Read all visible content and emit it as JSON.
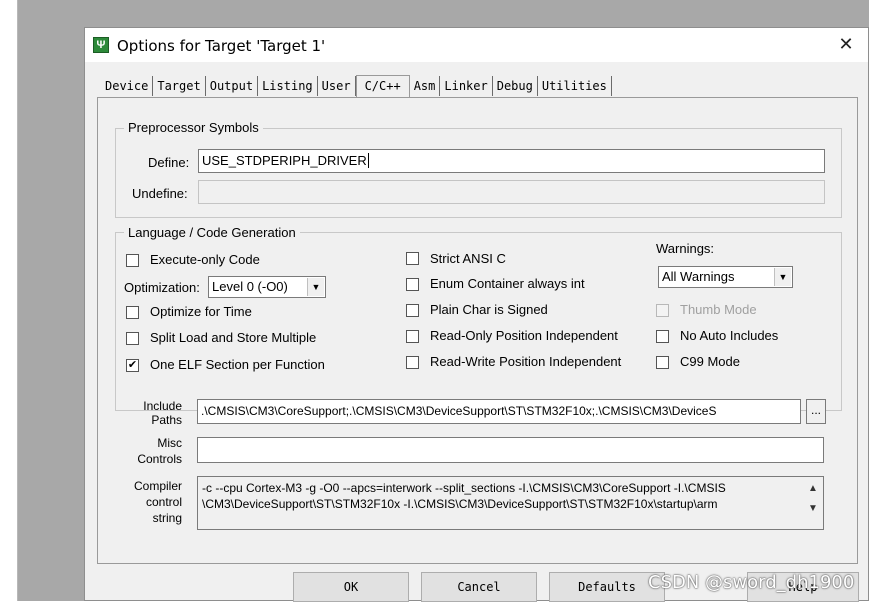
{
  "dialog": {
    "title": "Options for Target 'Target 1'",
    "icon": "keil-app-icon",
    "icon_glyph": "Ψ",
    "close_symbol": "✕"
  },
  "tabs": [
    "Device",
    "Target",
    "Output",
    "Listing",
    "User",
    "C/C++",
    "Asm",
    "Linker",
    "Debug",
    "Utilities"
  ],
  "active_tab": "C/C++",
  "preprocessor": {
    "legend": "Preprocessor Symbols",
    "define_label": "Define:",
    "define_value": "USE_STDPERIPH_DRIVER",
    "undefine_label": "Undefine:",
    "undefine_value": ""
  },
  "language": {
    "legend": "Language / Code Generation",
    "execute_only": {
      "label": "Execute-only Code",
      "checked": false
    },
    "optimization_label": "Optimization:",
    "optimization_value": "Level 0 (-O0)",
    "optimize_time": {
      "label": "Optimize for Time",
      "checked": false
    },
    "split_load": {
      "label": "Split Load and Store Multiple",
      "checked": false
    },
    "one_elf": {
      "label": "One ELF Section per Function",
      "checked": true
    },
    "strict_ansi": {
      "label": "Strict ANSI C",
      "checked": false
    },
    "enum_container": {
      "label": "Enum Container always int",
      "checked": false
    },
    "plain_char": {
      "label": "Plain Char is Signed",
      "checked": false
    },
    "ro_pos": {
      "label": "Read-Only Position Independent",
      "checked": false
    },
    "rw_pos": {
      "label": "Read-Write Position Independent",
      "checked": false
    },
    "warnings_label": "Warnings:",
    "warnings_value": "All Warnings",
    "thumb_mode": {
      "label": "Thumb Mode",
      "checked": false,
      "disabled": true
    },
    "no_auto_includes": {
      "label": "No Auto Includes",
      "checked": false
    },
    "c99_mode": {
      "label": "C99 Mode",
      "checked": false
    }
  },
  "include": {
    "label_line1": "Include",
    "label_line2": "Paths",
    "value": ".\\CMSIS\\CM3\\CoreSupport;.\\CMSIS\\CM3\\DeviceSupport\\ST\\STM32F10x;.\\CMSIS\\CM3\\DeviceS",
    "browse_label": "..."
  },
  "misc": {
    "label_line1": "Misc",
    "label_line2": "Controls",
    "value": ""
  },
  "compiler": {
    "label_line1": "Compiler",
    "label_line2": "control",
    "label_line3": "string",
    "line1": "-c --cpu Cortex-M3 -g -O0 --apcs=interwork --split_sections -I.\\CMSIS\\CM3\\CoreSupport -I.\\CMSIS",
    "line2": "\\CM3\\DeviceSupport\\ST\\STM32F10x -I.\\CMSIS\\CM3\\DeviceSupport\\ST\\STM32F10x\\startup\\arm"
  },
  "buttons": {
    "ok": "OK",
    "cancel": "Cancel",
    "defaults": "Defaults",
    "help": "Help"
  },
  "watermark": "CSDN @sword_dh1900"
}
